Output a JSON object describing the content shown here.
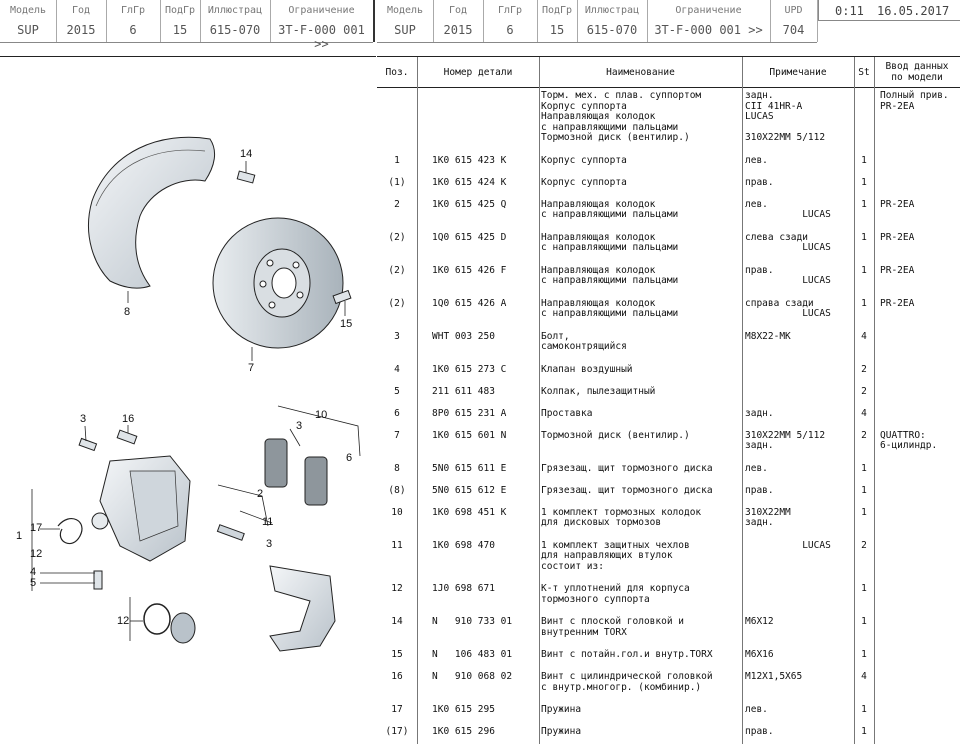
{
  "header_left": {
    "labels": [
      "Модель",
      "Год",
      "ГлГр",
      "ПодГр",
      "Иллюстрац",
      "Ограничение"
    ],
    "values": [
      "SUP",
      "2015",
      "6",
      "15",
      "615-070",
      "3T-F-000 001 >>"
    ]
  },
  "header_right": {
    "labels": [
      "Модель",
      "Год",
      "ГлГр",
      "ПодГр",
      "Иллюстрац",
      "Ограничение",
      "UPD"
    ],
    "values": [
      "SUP",
      "2015",
      "6",
      "15",
      "615-070",
      "3T-F-000 001 >>",
      "704"
    ]
  },
  "status": {
    "time": "0:11",
    "date": "16.05.2017"
  },
  "callouts": [
    "14",
    "8",
    "15",
    "7",
    "3",
    "16",
    "10",
    "3",
    "6",
    "2",
    "11",
    "3",
    "1",
    "17",
    "12",
    "4",
    "5",
    "12"
  ],
  "columns": [
    "Поз.",
    "Номер детали",
    "Наименование",
    "Примечание",
    "St",
    "Ввод данных\nпо модели"
  ],
  "rows": [
    {
      "pos": "",
      "part": "",
      "name": "Торм. мех. с плав. суппортом\nКорпус суппорта\nНаправляющая колодок\nс направляющими пальцами\nТормозной диск (вентилир.)",
      "note": "задн.\nCII 41HR-A\nLUCAS\n\n310X22MM 5/112",
      "st": "",
      "model": "Полный прив.\nPR-2EA"
    },
    {
      "pos": "1",
      "part": "1K0 615 423 K",
      "name": "Корпус суппорта",
      "note": "лев.",
      "st": "1",
      "model": ""
    },
    {
      "pos": "(1)",
      "part": "1K0 615 424 K",
      "name": "Корпус суппорта",
      "note": "прав.",
      "st": "1",
      "model": ""
    },
    {
      "pos": "2",
      "part": "1K0 615 425 Q",
      "name": "Направляющая колодок\nс направляющими пальцами",
      "note": "лев.\n          LUCAS",
      "st": "1",
      "model": "PR-2EA"
    },
    {
      "pos": "(2)",
      "part": "1Q0 615 425 D",
      "name": "Направляющая колодок\nс направляющими пальцами",
      "note": "слева сзади\n          LUCAS",
      "st": "1",
      "model": "PR-2EA"
    },
    {
      "pos": "(2)",
      "part": "1K0 615 426 F",
      "name": "Направляющая колодок\nс направляющими пальцами",
      "note": "прав.\n          LUCAS",
      "st": "1",
      "model": "PR-2EA"
    },
    {
      "pos": "(2)",
      "part": "1Q0 615 426 A",
      "name": "Направляющая колодок\nс направляющими пальцами",
      "note": "справа сзади\n          LUCAS",
      "st": "1",
      "model": "PR-2EA"
    },
    {
      "pos": "3",
      "part": "WHT 003 250",
      "name": "Болт,\nсамоконтрящийся",
      "note": "M8X22-MK",
      "st": "4",
      "model": ""
    },
    {
      "pos": "4",
      "part": "1K0 615 273 C",
      "name": "Клапан воздушный",
      "note": "",
      "st": "2",
      "model": ""
    },
    {
      "pos": "5",
      "part": "211 611 483",
      "name": "Колпак, пылезащитный",
      "note": "",
      "st": "2",
      "model": ""
    },
    {
      "pos": "6",
      "part": "8P0 615 231 A",
      "name": "Проставка",
      "note": "задн.",
      "st": "4",
      "model": ""
    },
    {
      "pos": "7",
      "part": "1K0 615 601 N",
      "name": "Тормозной диск (вентилир.)",
      "note": "310X22MM 5/112\nзадн.",
      "st": "2",
      "model": "QUATTRO:\n6-цилиндр."
    },
    {
      "pos": "8",
      "part": "5N0 615 611 E",
      "name": "Грязезащ. щит тормозного диска",
      "note": "лев.",
      "st": "1",
      "model": ""
    },
    {
      "pos": "(8)",
      "part": "5N0 615 612 E",
      "name": "Грязезащ. щит тормозного диска",
      "note": "прав.",
      "st": "1",
      "model": ""
    },
    {
      "pos": "10",
      "part": "1K0 698 451 K",
      "name": "1 комплект тормозных колодок\nдля дисковых тормозов",
      "note": "310X22MM\nзадн.",
      "st": "1",
      "model": ""
    },
    {
      "pos": "11",
      "part": "1K0 698 470",
      "name": "1 комплект защитных чехлов\nдля направляющих втулок\nсостоит из:",
      "note": "          LUCAS",
      "st": "2",
      "model": ""
    },
    {
      "pos": "12",
      "part": "1J0 698 671",
      "name": "К-т уплотнений для корпуса\nтормозного суппорта",
      "note": "",
      "st": "1",
      "model": ""
    },
    {
      "pos": "14",
      "part": "N   910 733 01",
      "name": "Винт с плоской головкой и\nвнутренним TORX",
      "note": "M6X12",
      "st": "1",
      "model": ""
    },
    {
      "pos": "15",
      "part": "N   106 483 01",
      "name": "Винт с потайн.гол.и внутр.TORX",
      "note": "M6X16",
      "st": "1",
      "model": ""
    },
    {
      "pos": "16",
      "part": "N   910 068 02",
      "name": "Винт с цилиндрической головкой\nс внутр.многогр. (комбинир.)",
      "note": "M12X1,5X65",
      "st": "4",
      "model": ""
    },
    {
      "pos": "17",
      "part": "1K0 615 295",
      "name": "Пружина",
      "note": "лев.",
      "st": "1",
      "model": ""
    },
    {
      "pos": "(17)",
      "part": "1K0 615 296",
      "name": "Пружина",
      "note": "прав.",
      "st": "1",
      "model": ""
    }
  ]
}
